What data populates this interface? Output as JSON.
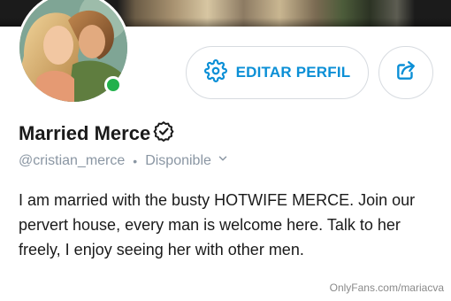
{
  "profile": {
    "name": "Married Merce",
    "username": "@cristian_merce",
    "separator": "•",
    "status": "Disponible",
    "bio": "I am married with the busty HOTWIFE MERCE. Join our pervert house, every man is welcome here. Talk to her freely, I enjoy seeing her with other men.",
    "online": true
  },
  "actions": {
    "edit_label": "EDITAR PERFIL",
    "edit_icon": "gear-icon",
    "share_icon": "share-icon"
  },
  "watermark": "OnlyFans.com/mariacva",
  "colors": {
    "accent": "#0b8fd6",
    "online": "#22b14c",
    "muted": "#8a96a3"
  }
}
